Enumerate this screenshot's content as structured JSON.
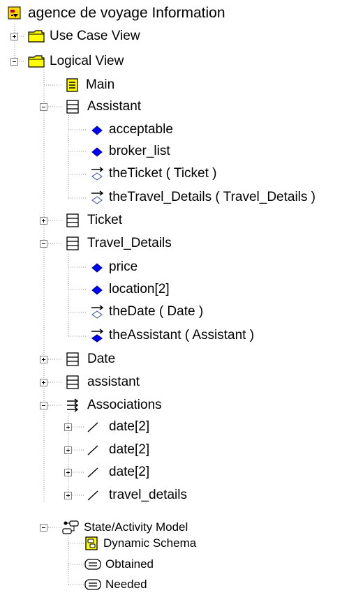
{
  "root": {
    "label": "agence de voyage Information",
    "icon": "rose-model-icon"
  },
  "tree": {
    "use_case_view": "Use Case View",
    "logical_view": "Logical View",
    "main": "Main",
    "assistant": {
      "label": "Assistant",
      "members": [
        "acceptable",
        "broker_list",
        "theTicket ( Ticket )",
        "theTravel_Details ( Travel_Details )"
      ]
    },
    "ticket": "Ticket",
    "travel_details": {
      "label": "Travel_Details",
      "members": [
        "price",
        "location[2]",
        "theDate ( Date )",
        "theAssistant ( Assistant )"
      ]
    },
    "date": "Date",
    "assistant_lower": "assistant",
    "associations": {
      "label": "Associations",
      "items": [
        "date[2]",
        "date[2]",
        "date[2]",
        "travel_details"
      ]
    },
    "state_model": {
      "label": "State/Activity Model",
      "items": [
        "Dynamic Schema",
        "Obtained",
        "Needed"
      ]
    }
  },
  "colors": {
    "folder": "#ffff00",
    "attribute": "#0000ff",
    "line": "#808080"
  }
}
